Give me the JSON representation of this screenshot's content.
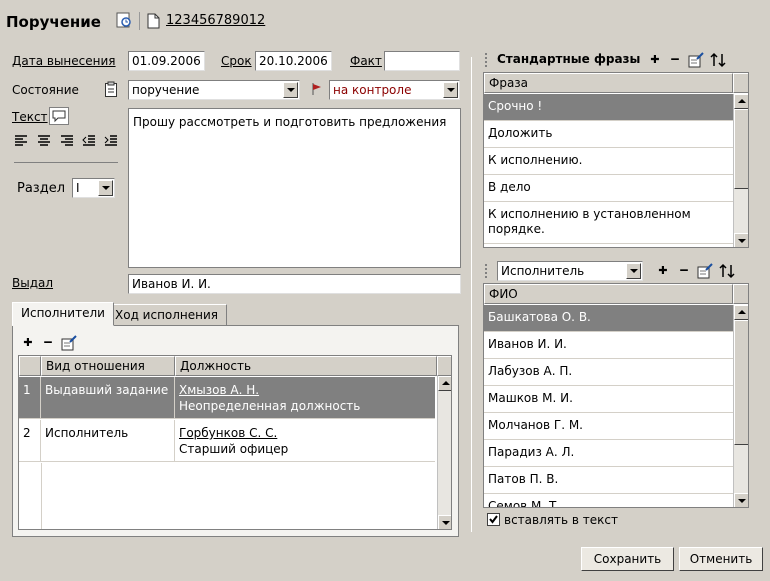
{
  "header": {
    "title": "Поручение",
    "doc_number": "123456789012"
  },
  "form": {
    "date_label": "Дата вынесения",
    "date_value": "01.09.2006",
    "term_label": "Срок",
    "term_value": "20.10.2006",
    "fact_label": "Факт",
    "fact_value": "",
    "state_label": "Состояние",
    "state_value": "поручение",
    "control_value": "на контроле",
    "text_label": "Текст",
    "text_value": "Прошу рассмотреть и подготовить предложения",
    "section_label": "Раздел",
    "section_value": "I",
    "issued_label": "Выдал",
    "issued_value": "Иванов И. И."
  },
  "tabs": [
    "Исполнители",
    "Ход исполнения"
  ],
  "executors": {
    "columns": [
      "Вид отношения",
      "Должность"
    ],
    "rows": [
      {
        "num": "1",
        "relation": "Выдавший задание",
        "name": "Хмызов А. Н.",
        "position": "Неопределенная должность"
      },
      {
        "num": "2",
        "relation": "Исполнитель",
        "name": "Горбунков С. С.",
        "position": "Старший офицер"
      }
    ]
  },
  "phrases": {
    "title": "Стандартные фразы",
    "column": "Фраза",
    "items": [
      "Срочно !",
      "Доложить",
      "К исполнению.",
      "В дело",
      "К исполнению в установленном порядке."
    ]
  },
  "people": {
    "filter_value": "Исполнитель",
    "column": "ФИО",
    "items": [
      "Башкатова О. В.",
      "Иванов И. И.",
      "Лабузов А. П.",
      "Машков М. И.",
      "Молчанов Г. М.",
      "Парадиз А. Л.",
      "Патов П. В.",
      "Семов М. Т."
    ]
  },
  "insert_label": "вставлять в текст",
  "buttons": {
    "save": "Сохранить",
    "cancel": "Отменить"
  },
  "colors": {
    "selection": "#808080",
    "control_text": "#8b0000",
    "background": "#d4d0c8"
  }
}
